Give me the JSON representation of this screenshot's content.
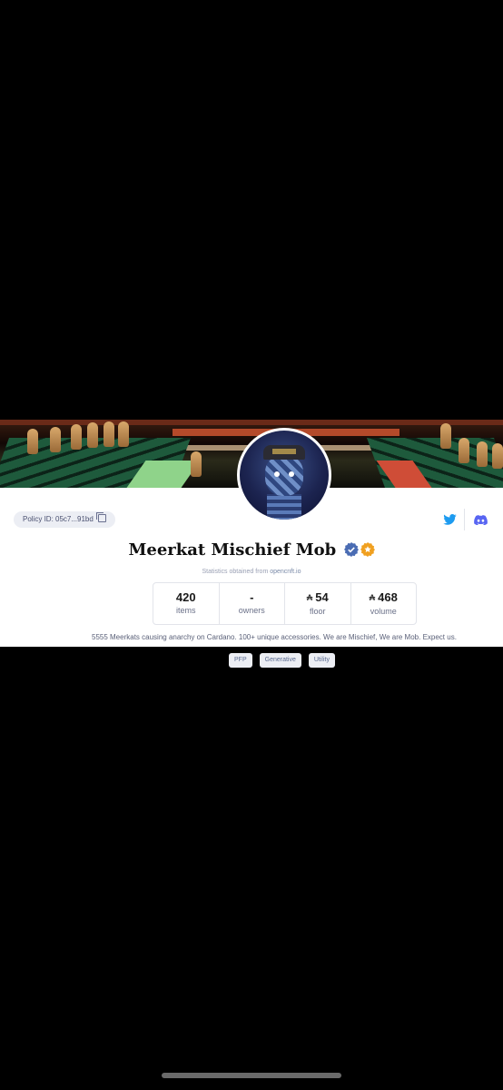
{
  "collection": {
    "policy_id": "Policy ID: 05c7...91bd",
    "name": "Meerkat Mischief Mob",
    "stats_source_prefix": "Statistics obtained from ",
    "stats_source_link": "opencnft.io",
    "stats": [
      {
        "value": "420",
        "label": "items"
      },
      {
        "value": "-",
        "label": "owners"
      },
      {
        "value": "54",
        "label": "floor",
        "currency": "₳"
      },
      {
        "value": "468",
        "label": "volume",
        "currency": "₳"
      }
    ],
    "description": "5555 Meerkats causing anarchy on Cardano. 100+ unique accessories. We are Mischief, We are Mob. Expect us.",
    "tags": [
      "PFP",
      "Generative",
      "Utility"
    ]
  },
  "icons": {
    "twitter": "twitter-icon",
    "discord": "discord-icon",
    "copy": "copy-icon",
    "verified": "verified-badge-icon",
    "secondary_badge": "orange-badge-icon"
  },
  "colors": {
    "twitter": "#1d9bf0",
    "discord": "#5865f2",
    "verified": "#4a6cb3",
    "badge_orange": "#f0a020"
  }
}
